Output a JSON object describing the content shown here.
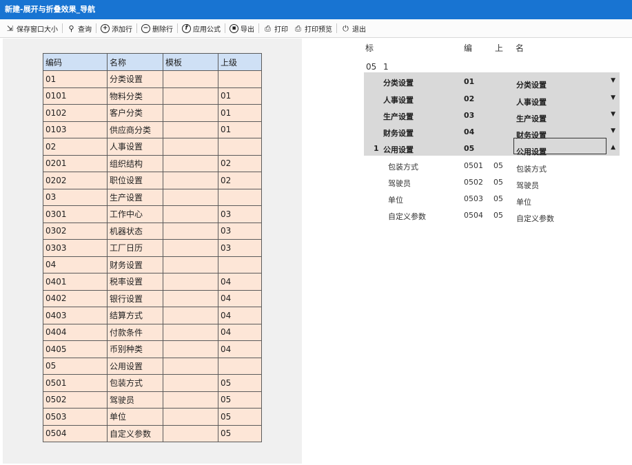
{
  "window": {
    "title": "新建-展开与折叠效果_导航"
  },
  "toolbar": {
    "save_size": "保存窗口大小",
    "query": "查询",
    "add_row": "添加行",
    "delete_row": "删除行",
    "apply_formula": "应用公式",
    "export": "导出",
    "print": "打印",
    "print_preview": "打印预览",
    "exit": "退出"
  },
  "table": {
    "headers": [
      "编码",
      "名称",
      "模板",
      "上级"
    ],
    "rows": [
      [
        "01",
        "分类设置",
        "",
        ""
      ],
      [
        "0101",
        "物料分类",
        "",
        "01"
      ],
      [
        "0102",
        "客户分类",
        "",
        "01"
      ],
      [
        "0103",
        "供应商分类",
        "",
        "01"
      ],
      [
        "02",
        "人事设置",
        "",
        ""
      ],
      [
        "0201",
        "组织结构",
        "",
        "02"
      ],
      [
        "0202",
        "职位设置",
        "",
        "02"
      ],
      [
        "03",
        "生产设置",
        "",
        ""
      ],
      [
        "0301",
        "工作中心",
        "",
        "03"
      ],
      [
        "0302",
        "机器状态",
        "",
        "03"
      ],
      [
        "0303",
        "工厂日历",
        "",
        "03"
      ],
      [
        "04",
        "财务设置",
        "",
        ""
      ],
      [
        "0401",
        "税率设置",
        "",
        "04"
      ],
      [
        "0402",
        "银行设置",
        "",
        "04"
      ],
      [
        "0403",
        "结算方式",
        "",
        "04"
      ],
      [
        "0404",
        "付款条件",
        "",
        "04"
      ],
      [
        "0405",
        "币别种类",
        "",
        "04"
      ],
      [
        "05",
        "公用设置",
        "",
        ""
      ],
      [
        "0501",
        "包装方式",
        "",
        "05"
      ],
      [
        "0502",
        "驾驶员",
        "",
        "05"
      ],
      [
        "0503",
        "单位",
        "",
        "05"
      ],
      [
        "0504",
        "自定义参数",
        "",
        "05"
      ]
    ]
  },
  "nav": {
    "headers": {
      "mark": "标",
      "code": "编",
      "parent": "上",
      "name": "名"
    },
    "state": {
      "expanded_code": "05",
      "mark": "1"
    },
    "groups": [
      {
        "mark": "",
        "label": "分类设置",
        "code": "01",
        "name": "分类设置",
        "arrow": "▼"
      },
      {
        "mark": "",
        "label": "人事设置",
        "code": "02",
        "name": "人事设置",
        "arrow": "▼"
      },
      {
        "mark": "",
        "label": "生产设置",
        "code": "03",
        "name": "生产设置",
        "arrow": "▼"
      },
      {
        "mark": "",
        "label": "财务设置",
        "code": "04",
        "name": "财务设置",
        "arrow": "▼"
      },
      {
        "mark": "1",
        "label": "公用设置",
        "code": "05",
        "name": "公用设置",
        "arrow": "▲"
      }
    ],
    "children": [
      {
        "label": "包装方式",
        "code": "0501",
        "parent": "05",
        "name": "包装方式"
      },
      {
        "label": "驾驶员",
        "code": "0502",
        "parent": "05",
        "name": "驾驶员"
      },
      {
        "label": "单位",
        "code": "0503",
        "parent": "05",
        "name": "单位"
      },
      {
        "label": "自定义参数",
        "code": "0504",
        "parent": "05",
        "name": "自定义参数"
      }
    ]
  }
}
